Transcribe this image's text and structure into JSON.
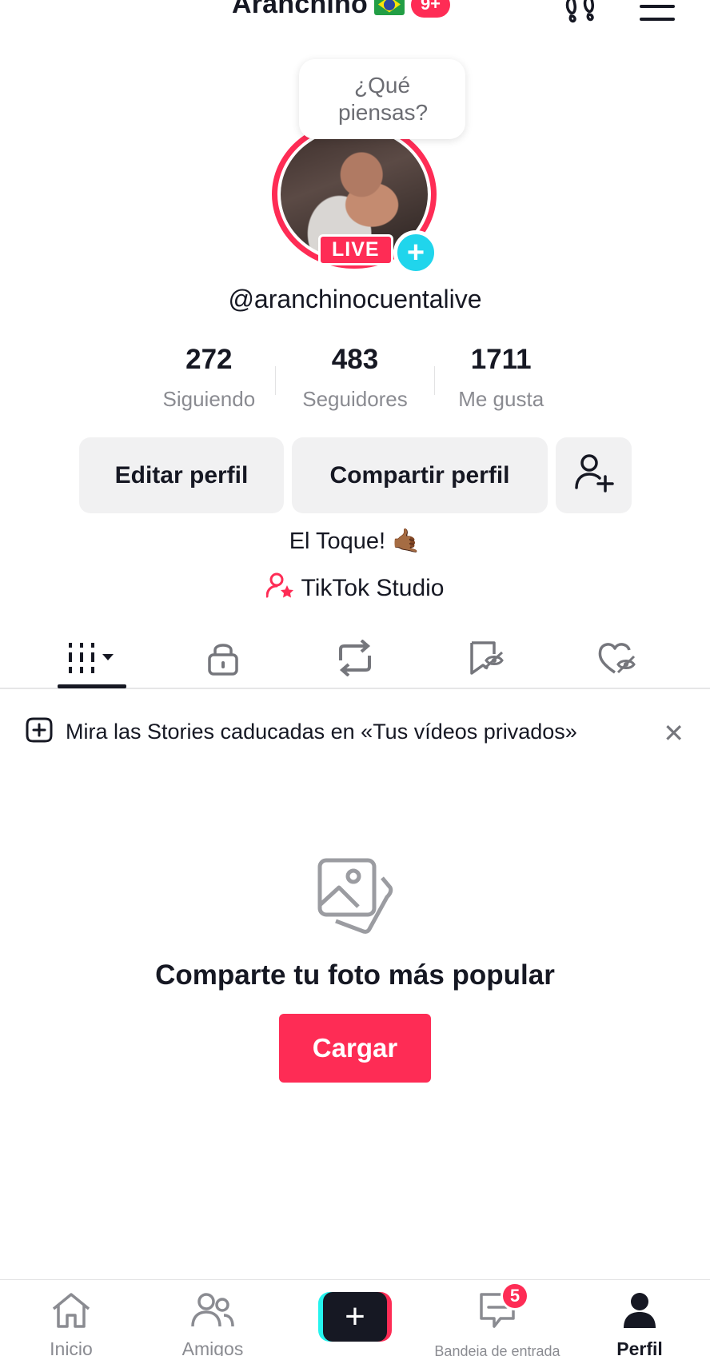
{
  "header": {
    "title": "Aranchino",
    "flag_icon": "brazil-flag-icon",
    "notification_badge": "9+",
    "right_icons": [
      "footprints-icon",
      "menu-icon"
    ]
  },
  "profile": {
    "note_bubble": "¿Qué piensas?",
    "live_label": "LIVE",
    "username": "@aranchinocuentalive",
    "stats": [
      {
        "value": "272",
        "label": "Siguiendo"
      },
      {
        "value": "483",
        "label": "Seguidores"
      },
      {
        "value": "1711",
        "label": "Me gusta"
      }
    ],
    "buttons": {
      "edit": "Editar perfil",
      "share": "Compartir perfil",
      "add_friends_icon": "add-user-icon"
    },
    "bio": "El Toque! 🤙🏾",
    "studio_label": "TikTok Studio"
  },
  "tabs": [
    "videos-grid-icon",
    "lock-icon",
    "repost-icon",
    "favorites-icon",
    "liked-icon"
  ],
  "banner": {
    "text": "Mira las Stories caducadas en «Tus vídeos privados»",
    "close": "✕"
  },
  "empty_state": {
    "title": "Comparte tu foto más popular",
    "button": "Cargar"
  },
  "bottom_nav": {
    "items": [
      {
        "label": "Inicio",
        "icon": "home-icon"
      },
      {
        "label": "Amigos",
        "icon": "friends-icon"
      },
      {
        "label": "",
        "icon": "create-icon"
      },
      {
        "label": "Bandeja de entrada",
        "icon": "inbox-icon",
        "badge": "5"
      },
      {
        "label": "Perfil",
        "icon": "profile-icon"
      }
    ]
  },
  "colors": {
    "accent": "#fe2c55",
    "cyan": "#20d5ec",
    "text": "#161823",
    "muted": "#8a8b91"
  }
}
